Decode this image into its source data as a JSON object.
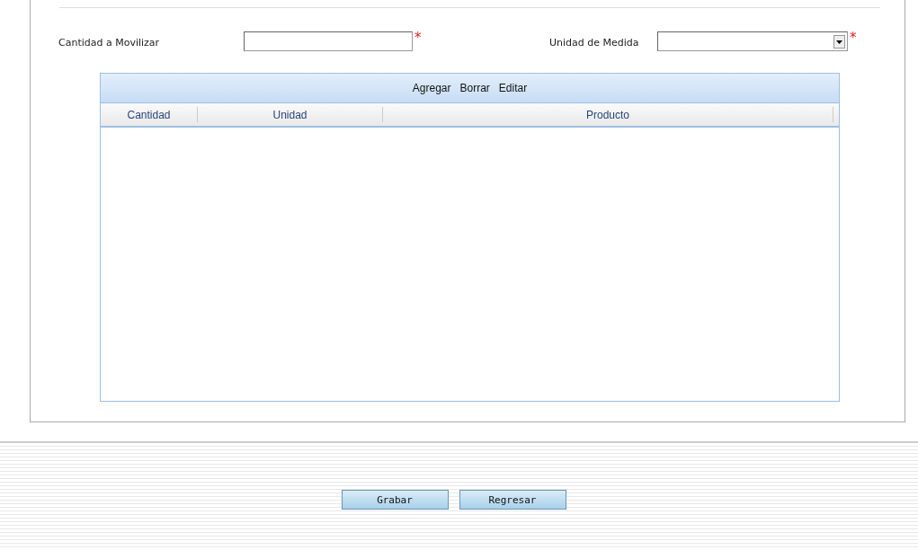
{
  "form": {
    "fields": [
      {
        "kind": "text",
        "label": "Cantidad a Movilizar",
        "required_mark": "*"
      },
      {
        "kind": "select",
        "label": "Unidad de Medida",
        "required_mark": "*"
      }
    ]
  },
  "grid": {
    "actions": [
      "Agregar",
      "Borrar",
      "Editar"
    ],
    "columns": [
      "Cantidad",
      "Unidad",
      "Producto"
    ]
  },
  "buttons": [
    "Grabar",
    "Regresar"
  ]
}
